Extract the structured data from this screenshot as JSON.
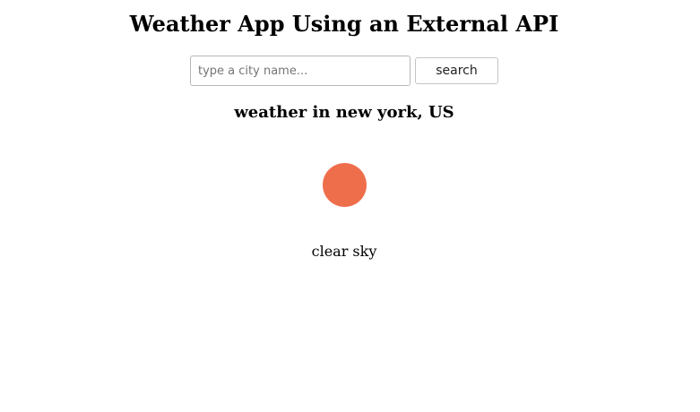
{
  "header": {
    "title": "Weather App Using an External API"
  },
  "search": {
    "placeholder": "type a city name...",
    "value": "",
    "button_label": "search"
  },
  "result": {
    "location_heading": "weather in new york, US",
    "icon_name": "sun-icon",
    "icon_color": "#ee6e4c",
    "description": "clear sky"
  }
}
